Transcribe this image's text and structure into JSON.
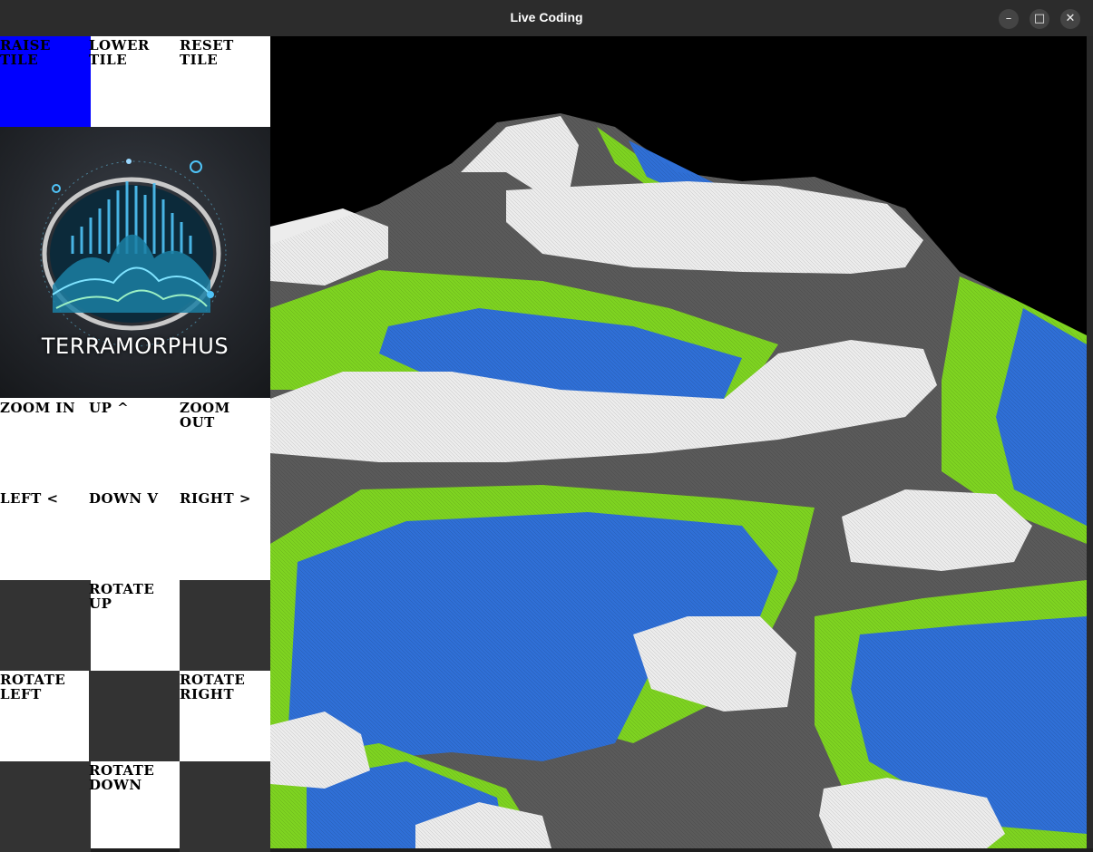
{
  "window": {
    "title": "Live Coding",
    "minimize_glyph": "–",
    "maximize_glyph": "□",
    "close_glyph": "✕"
  },
  "logo": {
    "text": "TERRAMORPHUS"
  },
  "controls": {
    "raise_tile": "RAISE TILE",
    "lower_tile": "LOWER TILE",
    "reset_tile": "RESET TILE",
    "zoom_in": "ZOOM IN",
    "up": "UP ^",
    "zoom_out": "ZOOM OUT",
    "left": "LEFT <",
    "down": "DOWN V",
    "right": "RIGHT >",
    "rotate_up": "ROTATE UP",
    "rotate_left": "ROTATE LEFT",
    "rotate_right": "ROTATE RIGHT",
    "rotate_down": "ROTATE DOWN"
  },
  "colors": {
    "selected": "#0000ff",
    "snow": "#ececec",
    "rock": "#5a5a5a",
    "grass": "#7ed321",
    "water": "#2f6fd6",
    "sky": "#000000"
  }
}
